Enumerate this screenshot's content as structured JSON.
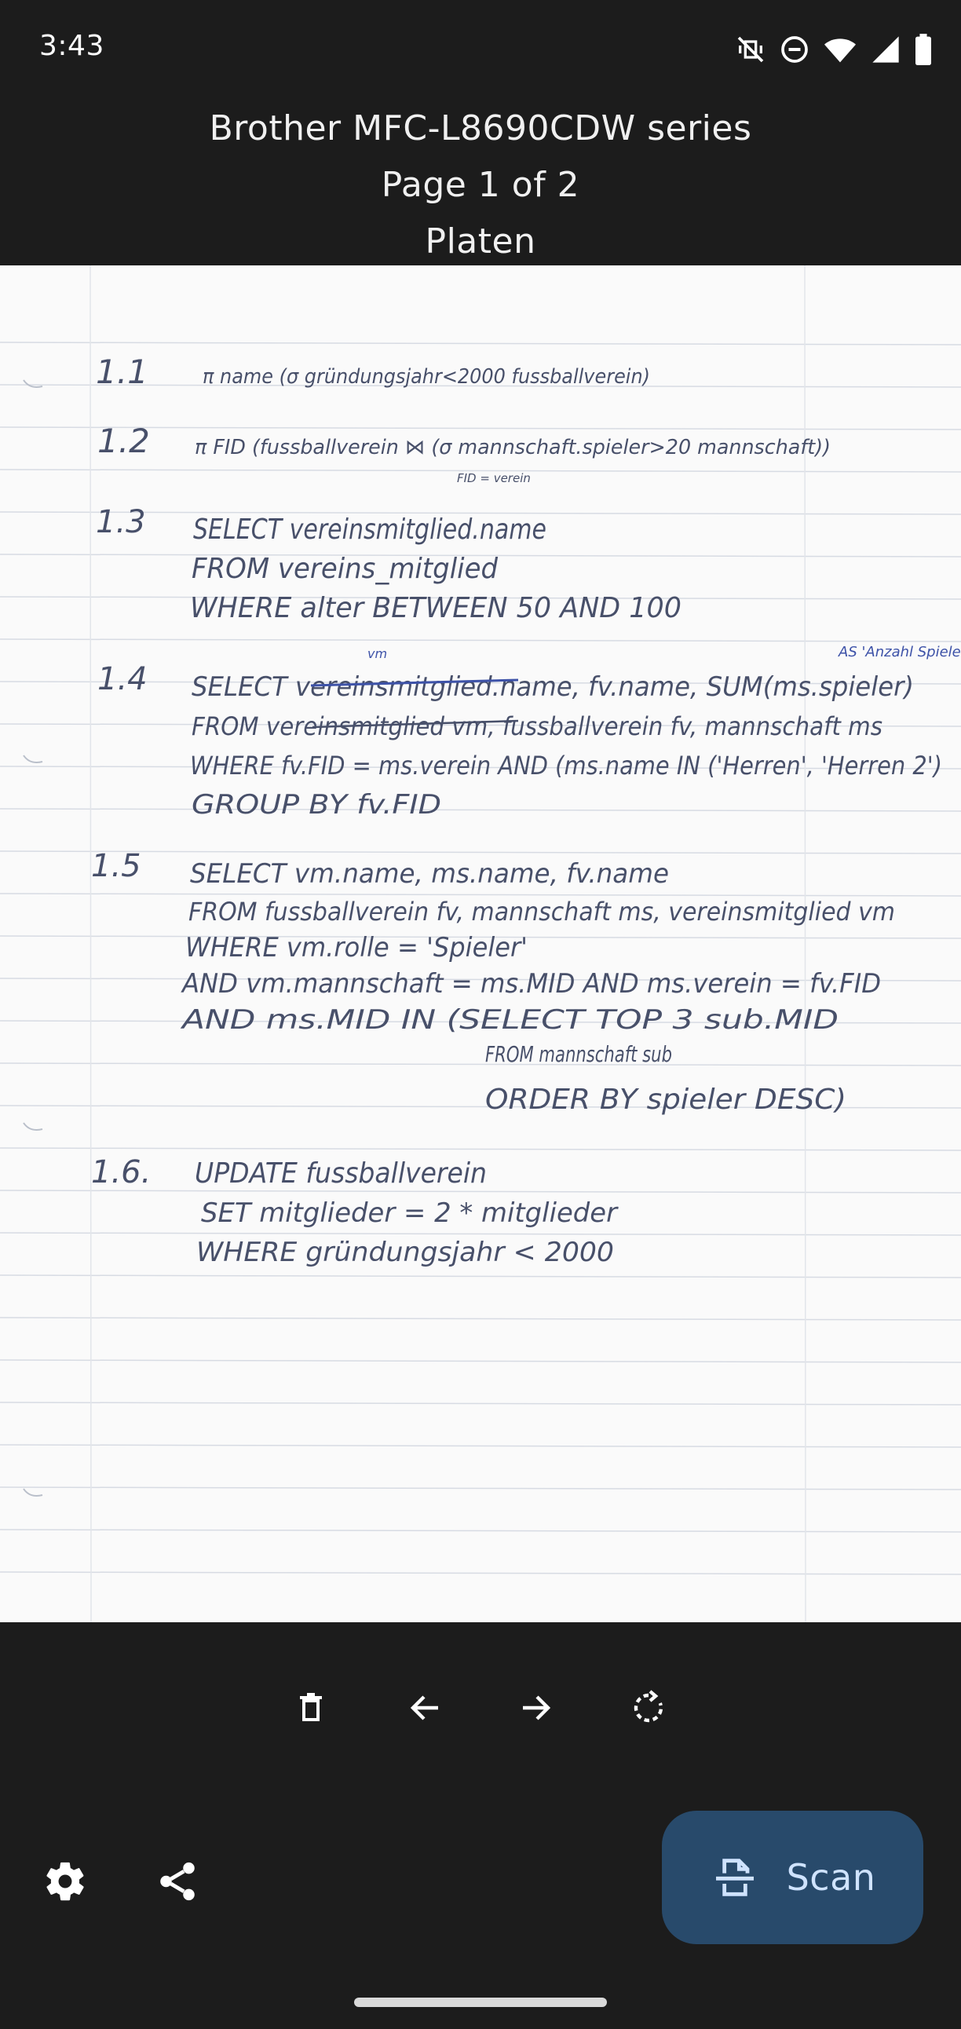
{
  "status_bar": {
    "time": "3:43",
    "icons": [
      "vibrate-off-icon",
      "do-not-disturb-icon",
      "wifi-icon",
      "cellular-signal-icon",
      "battery-icon"
    ]
  },
  "header": {
    "device_name": "Brother MFC-L8690CDW series",
    "page_indicator": "Page 1 of 2",
    "source": "Platen"
  },
  "scanned_page": {
    "handwriting": {
      "l1": "1.1",
      "l1_text": "π name (σ gründungsjahr<2000 fussballverein)",
      "l2": "1.2",
      "l2_text": "π FID (fussballverein ⋈ (σ mannschaft.spieler>20 mannschaft))",
      "l2_sub": "FID = verein",
      "l3": "1.3",
      "l3_a": "SELECT  vereinsmitglied.name",
      "l3_b": "FROM  vereins_mitglied",
      "l3_c": "WHERE  alter BETWEEN 50 AND 100",
      "l4": "1.4",
      "l4_note": "AS 'Anzahl Spieler'",
      "l4_note_top": "vm",
      "l4_a": "SELECT  vereinsmitglied.name, fv.name, SUM(ms.spieler)",
      "l4_b": "FROM  vereinsmitglied vm, fussballverein fv, mannschaft ms",
      "l4_c": "WHERE  fv.FID = ms.verein  AND (ms.name IN ('Herren', 'Herren 2')",
      "l4_d": "GROUP BY  fv.FID",
      "l5": "1.5",
      "l5_a": "SELECT  vm.name, ms.name, fv.name",
      "l5_b": "FROM  fussballverein fv, mannschaft ms, vereinsmitglied vm",
      "l5_c": "WHERE  vm.rolle = 'Spieler'",
      "l5_d": "AND  vm.mannschaft = ms.MID  AND  ms.verein = fv.FID",
      "l5_e": "AND  ms.MID IN (SELECT TOP 3 sub.MID",
      "l5_f": "FROM  mannschaft sub",
      "l5_g": "ORDER BY spieler DESC)",
      "l6": "1.6.",
      "l6_a": "UPDATE  fussballverein",
      "l6_b": "SET  mitglieder = 2 * mitglieder",
      "l6_c": "WHERE  gründungsjahr < 2000"
    }
  },
  "toolbar": {
    "delete_icon": "trash-icon",
    "previous_icon": "arrow-left-icon",
    "next_icon": "arrow-right-icon",
    "rotate_icon": "rotate-icon"
  },
  "bottom_bar": {
    "settings_icon": "gear-icon",
    "share_icon": "share-icon",
    "scan_label": "Scan"
  },
  "colors": {
    "background": "#1c1c1c",
    "fab": "#284a6b",
    "fab_text": "#cfe3ff",
    "paper": "#fafafa",
    "ink": "#48506a",
    "ink_blue": "#3d52a8"
  }
}
